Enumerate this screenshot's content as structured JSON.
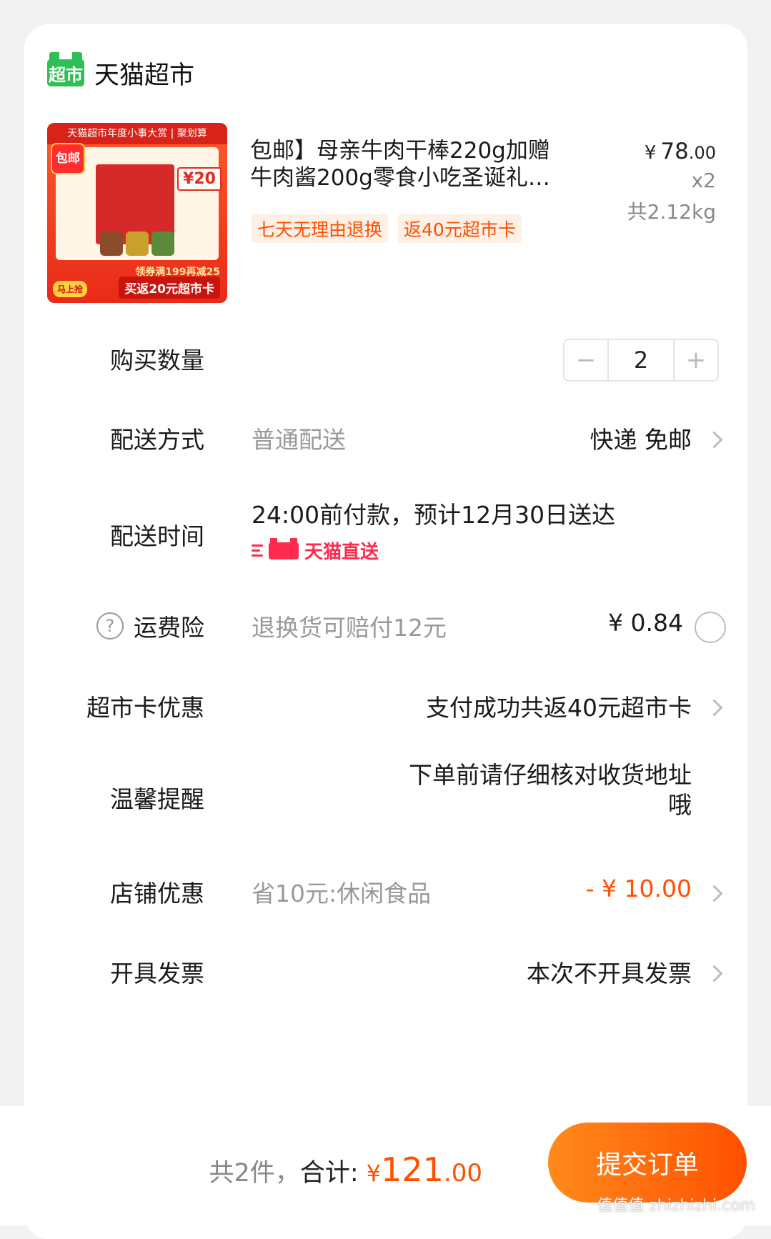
{
  "store": {
    "logo_text": "超市",
    "name": "天猫超市"
  },
  "product": {
    "image": {
      "top_banner": "天猫超市年度小事大赏 | 聚划算",
      "badge": "包邮",
      "price_tag": "¥20",
      "coupon": "领券满199再减25",
      "cashback": "买返20元超市卡",
      "corner": "马上抢"
    },
    "title": "包邮】母亲牛肉干棒220g加赠牛肉酱200g零食小吃圣诞礼…",
    "tags": [
      "七天无理由退换",
      "返40元超市卡"
    ],
    "price_currency": "¥",
    "price_int": "78",
    "price_dec": ".00",
    "quantity_text": "x2",
    "weight_text": "共2.12kg"
  },
  "quantity": {
    "label": "购买数量",
    "value": "2",
    "minus": "−",
    "plus": "+"
  },
  "delivery": {
    "label": "配送方式",
    "desc": "普通配送",
    "value": "快递 免邮"
  },
  "delivery_time": {
    "label": "配送时间",
    "value": "24:00前付款，预计12月30日送达",
    "badge": "天猫直送"
  },
  "shipping_insurance": {
    "label": "运费险",
    "help": "?",
    "desc": "退换货可赔付12元",
    "value": "¥ 0.84"
  },
  "card_discount": {
    "label": "超市卡优惠",
    "value": "支付成功共返40元超市卡"
  },
  "reminder": {
    "label": "温馨提醒",
    "value_line1": "下单前请仔细核对收货地址",
    "value_line2": "哦"
  },
  "shop_discount": {
    "label": "店铺优惠",
    "desc": "省10元:休闲食品",
    "value": "- ¥ 10.00"
  },
  "invoice": {
    "label": "开具发票",
    "value": "本次不开具发票"
  },
  "footer": {
    "count_text": "共2件，",
    "total_label": "合计:",
    "currency": "¥",
    "total_int": "121",
    "total_dec": ".00",
    "submit": "提交订单",
    "watermark": "值值值 zhizhizhi.com"
  },
  "colors": {
    "accent": "#ff5000",
    "brand_green": "#2fbf55",
    "direct_red": "#ff2a50"
  }
}
